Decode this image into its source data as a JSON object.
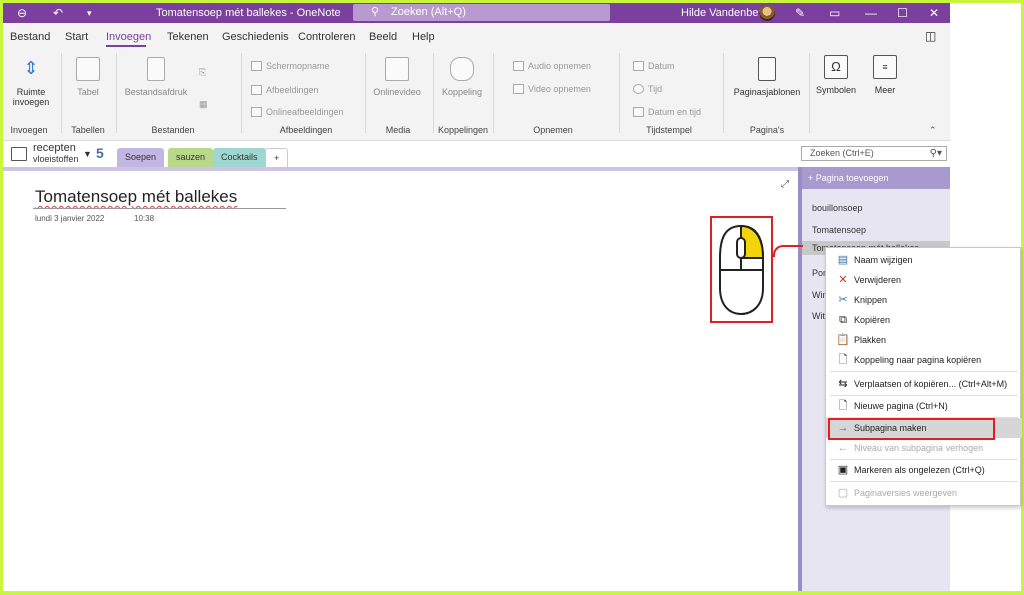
{
  "titlebar": {
    "title": "Tomatensoep mét ballekes  -  OneNote",
    "search_placeholder": "Zoeken (Alt+Q)",
    "user": "Hilde Vandenberk",
    "back_icon": "back-arrow-icon",
    "undo_icon": "undo-icon",
    "pen_icon": "pen-icon",
    "ribbon_options_icon": "ribbon-display-icon",
    "minimize": "—",
    "maximize": "☐",
    "close": "✕"
  },
  "menu": {
    "tabs": [
      "Bestand",
      "Start",
      "Invoegen",
      "Tekenen",
      "Geschiedenis",
      "Controleren",
      "Beeld",
      "Help"
    ],
    "active": "Invoegen"
  },
  "ribbon": {
    "space": "Ruimte invoegen",
    "table": "Tabel",
    "fileprint": "Bestandsafdruk",
    "screenshot": "Schermopname",
    "images": "Afbeeldingen",
    "online_images": "Onlineafbeeldingen",
    "online_video": "Onlinevideo",
    "link": "Koppeling",
    "audio": "Audio opnemen",
    "video": "Video opnemen",
    "date": "Datum",
    "time": "Tijd",
    "datetime": "Datum en tijd",
    "page_templates": "Paginasjablonen",
    "symbols": "Symbolen",
    "more": "Meer",
    "groups": [
      "Invoegen",
      "Tabellen",
      "Bestanden",
      "Afbeeldingen",
      "Media",
      "Koppelingen",
      "Opnemen",
      "Tijdstempel",
      "Pagina's"
    ]
  },
  "notebook": {
    "name_line1": "recepten",
    "name_line2": "vloeistoffen",
    "sections": [
      {
        "label": "Soepen",
        "color": "#c2b6e2"
      },
      {
        "label": "sauzen",
        "color": "#b8d88a"
      },
      {
        "label": "Cocktails",
        "color": "#9fd7d0"
      },
      {
        "label": "+",
        "color": "#ffffff"
      }
    ],
    "find_placeholder": "Zoeken (Ctrl+E)"
  },
  "page": {
    "title": "Tomatensoep mét ballekes",
    "date": "lundi 3 janvier 2022",
    "time": "10:38"
  },
  "pagelist": {
    "add_label": "Pagina toevoegen",
    "pages": [
      "bouillonsoep",
      "Tomatensoep",
      "Tomatensoep mét ballekes",
      "Pom",
      "Wint",
      "Witlo"
    ]
  },
  "context_menu": {
    "items": [
      {
        "label": "Naam wijzigen",
        "icon": "rename-icon",
        "disabled": false
      },
      {
        "label": "Verwijderen",
        "icon": "delete-x-icon",
        "disabled": false
      },
      {
        "label": "Knippen",
        "icon": "scissors-icon",
        "disabled": false
      },
      {
        "label": "Kopiëren",
        "icon": "copy-icon",
        "disabled": false
      },
      {
        "label": "Plakken",
        "icon": "paste-icon",
        "disabled": false
      },
      {
        "label": "Koppeling naar pagina kopiëren",
        "icon": "link-icon",
        "disabled": false
      },
      {
        "label": "Verplaatsen of kopiëren...  (Ctrl+Alt+M)",
        "icon": "move-icon",
        "disabled": false
      },
      {
        "label": "Nieuwe pagina  (Ctrl+N)",
        "icon": "new-page-icon",
        "disabled": false
      },
      {
        "label": "Subpagina maken",
        "icon": "indent-arrow-icon",
        "disabled": false
      },
      {
        "label": "Niveau van subpagina verhogen",
        "icon": "outdent-arrow-icon",
        "disabled": true
      },
      {
        "label": "Markeren als ongelezen  (Ctrl+Q)",
        "icon": "unread-icon",
        "disabled": false
      },
      {
        "label": "Paginaversies weergeven",
        "icon": "versions-icon",
        "disabled": true
      }
    ]
  },
  "colors": {
    "accent": "#7b3f9e",
    "highlight": "#e02020",
    "mouse_button": "#f2d40a"
  }
}
